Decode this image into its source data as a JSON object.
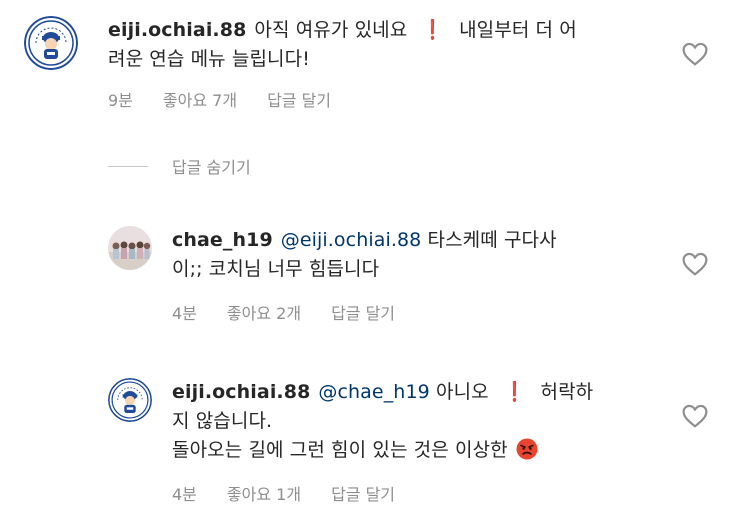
{
  "comments": [
    {
      "username": "eiji.ochiai.88",
      "text_part1": "아직 여유가 있네요",
      "exclamation": "❗",
      "text_part2": "내일부터 더 어",
      "line2": "려운 연습 메뉴 늘립니다!",
      "time": "9분",
      "likes": "좋아요 7개",
      "reply": "답글 달기"
    },
    {
      "username": "chae_h19",
      "mention": "@eiji.ochiai.88",
      "text_part1": "타스케떼 구다사",
      "line2": "이;; 코치님 너무 힘듭니다",
      "time": "4분",
      "likes": "좋아요 2개",
      "reply": "답글 달기"
    },
    {
      "username": "eiji.ochiai.88",
      "mention": "@chae_h19",
      "text_part1": "아니오",
      "exclamation": "❗",
      "text_part2": "허락하",
      "line2": "지 않습니다.",
      "line3": "돌아오는 길에 그런 힘이 있는 것은 이상한",
      "emoji": "angry-face-emoji",
      "time": "4분",
      "likes": "좋아요 1개",
      "reply": "답글 달기"
    }
  ],
  "hide_replies": "답글 숨기기",
  "icons": {
    "heart": "heart-outline-icon",
    "avatar_primary": "baseball-mascot-avatar",
    "avatar_group": "group-photo-avatar"
  },
  "colors": {
    "text": "#262626",
    "meta": "#8e8e8e",
    "mention": "#00376b",
    "exclamation": "#e0245e"
  }
}
